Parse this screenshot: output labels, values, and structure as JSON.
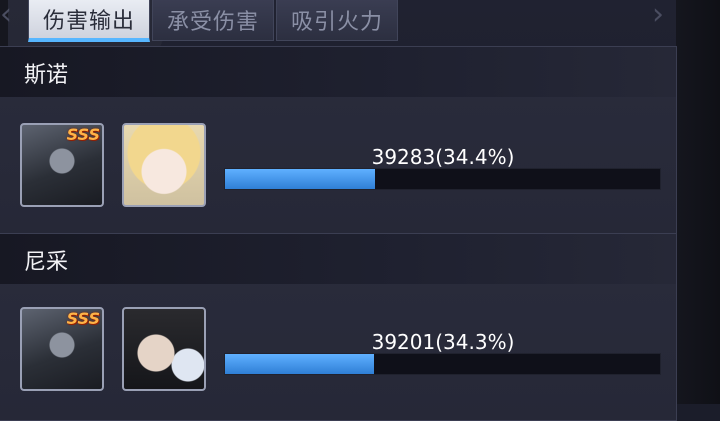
{
  "tabs": [
    {
      "label": "伤害输出",
      "active": true
    },
    {
      "label": "承受伤害",
      "active": false
    },
    {
      "label": "吸引火力",
      "active": false
    }
  ],
  "players": [
    {
      "name": "斯诺",
      "mech_rank": "SSS",
      "value_text": "39283(34.4%)",
      "share": 0.344
    },
    {
      "name": "尼采",
      "mech_rank": "SSS",
      "value_text": "39201(34.3%)",
      "share": 0.343
    }
  ],
  "colors": {
    "accent": "#57b6ff",
    "bar_fill": "#3c8fe6",
    "bar_track": "#0f1019",
    "rank": "#ffb347"
  },
  "icons": {
    "prev": "chevron-left-icon",
    "next": "chevron-right-icon"
  }
}
